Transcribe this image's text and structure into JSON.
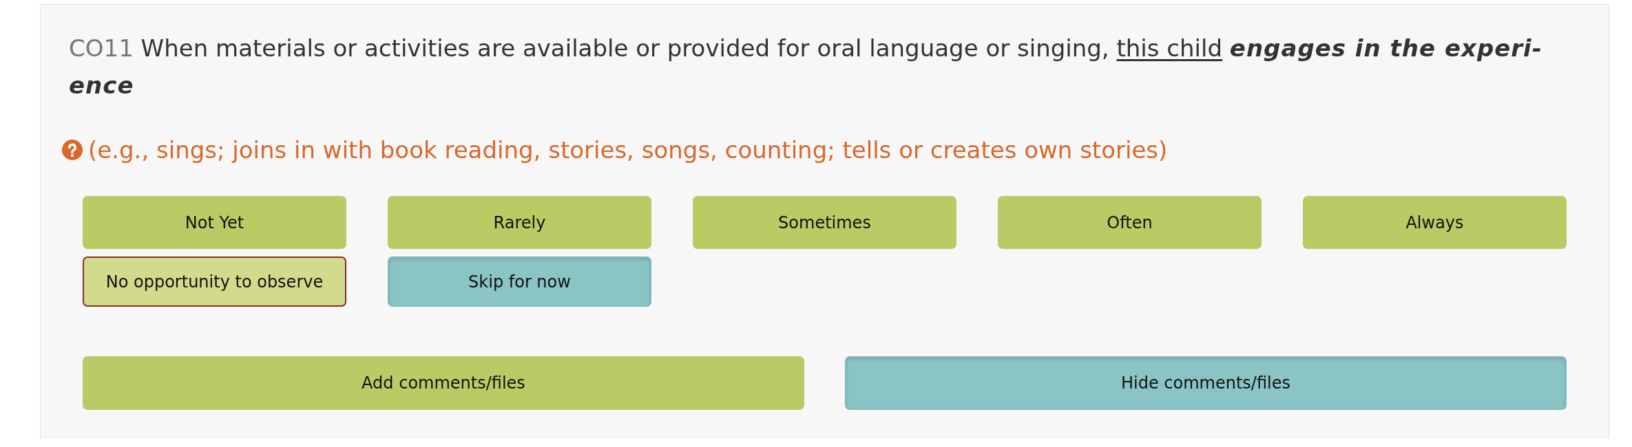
{
  "item": {
    "code": "CO11",
    "text": "When materials or activities are available or provided for oral language or singing,",
    "underlined": "this child",
    "emphasis": "engages in the experi-\nence"
  },
  "hint": {
    "text": "(e.g., sings; joins in with book reading, stories, songs, counting; tells or creates own stories)"
  },
  "ratings": [
    {
      "label": "Not Yet",
      "selected": false
    },
    {
      "label": "Rarely",
      "selected": false
    },
    {
      "label": "Sometimes",
      "selected": false
    },
    {
      "label": "Often",
      "selected": false
    },
    {
      "label": "Always",
      "selected": false
    }
  ],
  "extra_options": [
    {
      "label": "No opportunity to observe",
      "kind": "outlined",
      "selected": false
    },
    {
      "label": "Skip for now",
      "kind": "plain",
      "selected": true
    }
  ],
  "actions": [
    {
      "label": "Add comments/files",
      "selected": false
    },
    {
      "label": "Hide comments/files",
      "selected": true
    }
  ]
}
